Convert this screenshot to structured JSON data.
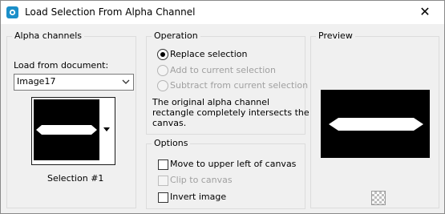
{
  "window": {
    "title": "Load Selection From Alpha Channel",
    "close_label": "✕"
  },
  "alpha_channels": {
    "group_title": "Alpha channels",
    "load_from_label": "Load from document:",
    "document": "Image17",
    "selection_name": "Selection #1"
  },
  "operation": {
    "group_title": "Operation",
    "options": [
      {
        "label": "Replace selection",
        "selected": true,
        "enabled": true
      },
      {
        "label": "Add to current selection",
        "selected": false,
        "enabled": false
      },
      {
        "label": "Subtract from current selection",
        "selected": false,
        "enabled": false
      }
    ],
    "info_lines": [
      "The original alpha channel",
      "rectangle completely intersects the",
      "canvas."
    ]
  },
  "options": {
    "group_title": "Options",
    "items": [
      {
        "label": "Move to upper left of canvas",
        "checked": false,
        "enabled": true
      },
      {
        "label": "Clip to canvas",
        "checked": false,
        "enabled": false
      },
      {
        "label": "Invert image",
        "checked": false,
        "enabled": true
      }
    ]
  },
  "preview": {
    "group_title": "Preview"
  },
  "icons": {
    "app": "paint-shop-icon",
    "close": "close-icon",
    "dropdown": "chevron-down-icon",
    "checkerboard": "checkerboard-icon"
  }
}
